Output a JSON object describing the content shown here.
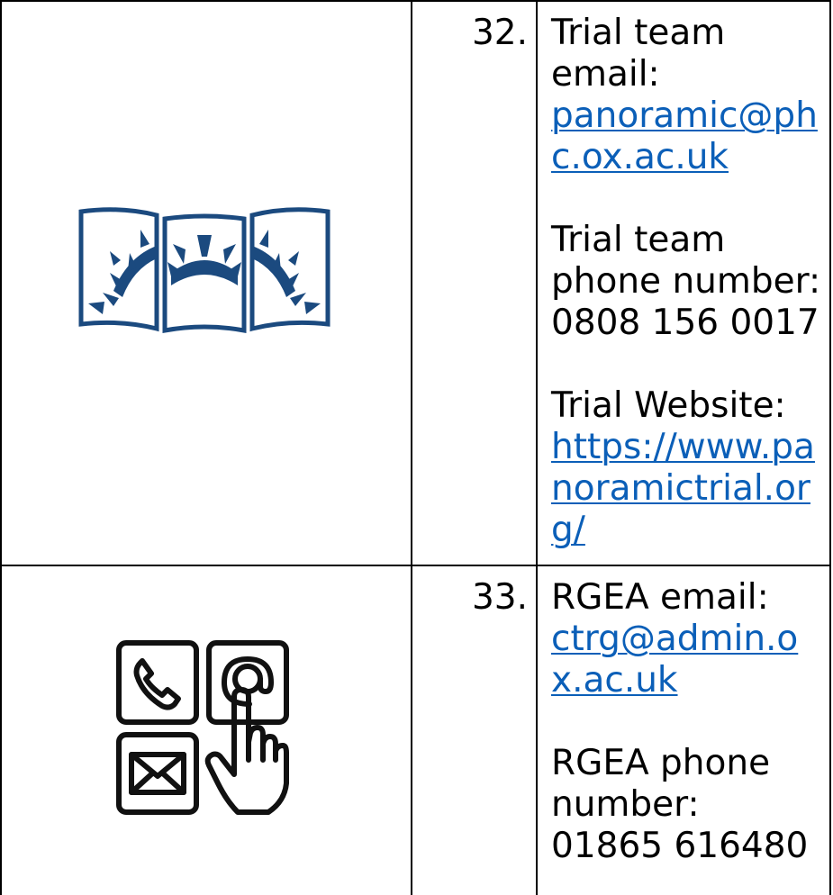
{
  "rows": [
    {
      "number": "32.",
      "icon": "panoramic-trial-logo-icon",
      "email_label": "Trial team email:",
      "email_value": "panoramic@phc.ox.ac.uk",
      "phone_label": "Trial team phone number:",
      "phone_value": "0808 156 0017",
      "website_label": "Trial Website:",
      "website_value": "https://www.panoramictrial.org/"
    },
    {
      "number": "33.",
      "icon": "contact-methods-icon",
      "email_label": "RGEA email:",
      "email_value": "ctrg@admin.ox.ac.uk",
      "phone_label": "RGEA phone number:",
      "phone_value": "01865 616480"
    }
  ],
  "colors": {
    "logo_blue": "#1b4a7f",
    "link_blue": "#0b5fb8",
    "border": "#000000"
  }
}
